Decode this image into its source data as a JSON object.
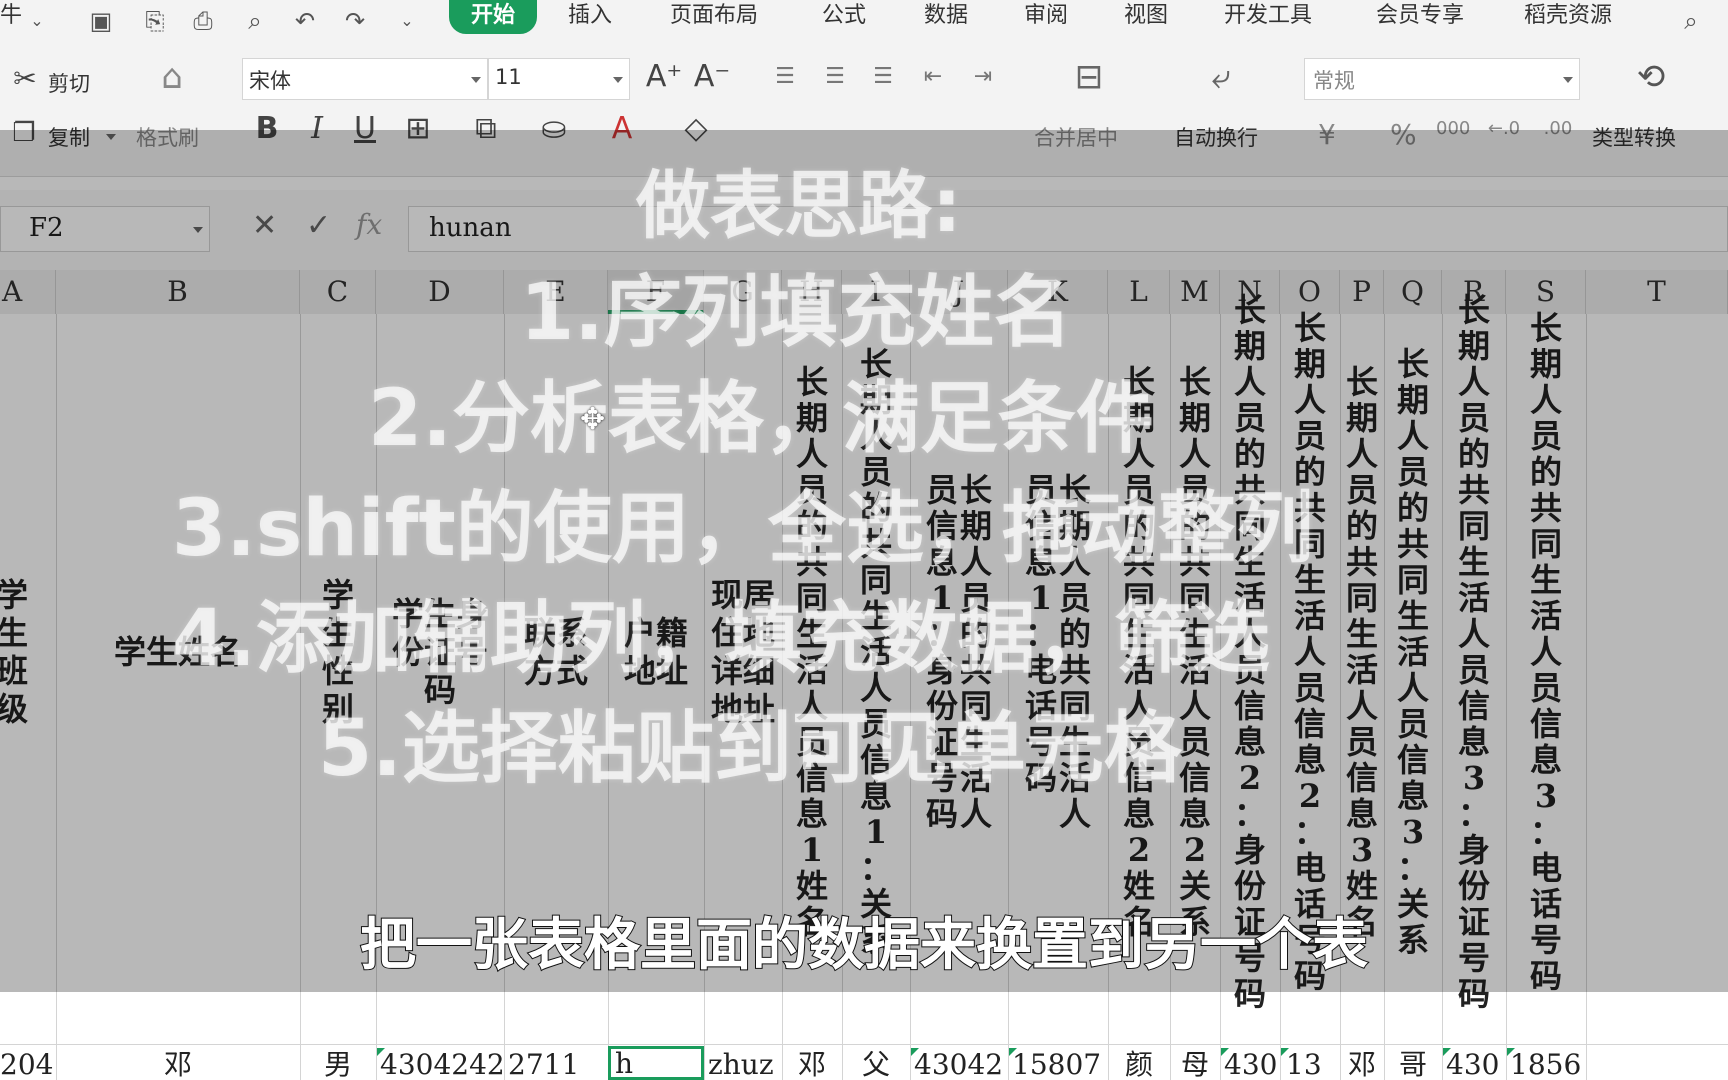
{
  "menubar": {
    "quick_icons": [
      "save-icon",
      "export-icon",
      "print-icon",
      "print-preview-icon",
      "undo-icon",
      "redo-icon",
      "more-icon"
    ],
    "tabs": [
      "开始",
      "插入",
      "页面布局",
      "公式",
      "数据",
      "审阅",
      "视图",
      "开发工具",
      "会员专享",
      "稻壳资源"
    ],
    "active_tab": "开始",
    "left_fragment": "牛"
  },
  "ribbon": {
    "cut": "剪切",
    "copy": "复制",
    "format_painter": "格式刷",
    "font_name": "宋体",
    "font_size": "11",
    "merge_center": "合并居中",
    "wrap_text": "自动换行",
    "number_format": "常规",
    "type_convert": "类型转换",
    "currency": "¥",
    "percent": "%",
    "thousands": "000"
  },
  "formula_bar": {
    "cell_ref": "F2",
    "value": "hunan",
    "fx": "fx"
  },
  "columns": [
    "A",
    "B",
    "C",
    "D",
    "E",
    "F",
    "G",
    "H",
    "I",
    "J",
    "K",
    "L",
    "M",
    "N",
    "O",
    "P",
    "Q",
    "R",
    "S",
    "T"
  ],
  "selected_column": "F",
  "header_row": {
    "A": "学生班级",
    "B": "学生姓名",
    "C": "学生性别",
    "D": "学生身份证号码",
    "E": "联系方式",
    "F": "户籍地址",
    "G": "现居住地详细地址",
    "H": "长期人员的共同生活人员信息1姓名",
    "I": "长期人员的共同生活人员信息1：关系",
    "J": "长期人员的共同生活人员信息1：身份证号码",
    "K": "长期人员的共同生活人员信息1：电话号码",
    "L": "长期人员的共同生活人员信息2姓名",
    "M": "长期人员的共同生活人员信息2关系",
    "N": "长期人员的共同生活人员信息2：身份证号码",
    "O": "长期人员的共同生活人员信息2：电话号码",
    "P": "长期人员的共同生活人员信息3姓名",
    "Q": "长期人员的共同生活人员信息3：关系",
    "R": "长期人员的共同生活人员信息3：身份证号码",
    "S": "长期人员的共同生活人员信息3：电话号码"
  },
  "data_row": {
    "A": "204",
    "B": "邓",
    "C": "男",
    "D": "4304242",
    "E": "2711",
    "F": "h",
    "G": "zhuz",
    "H": "邓",
    "I": "父",
    "J": "43042",
    "K": "15807",
    "L": "颜",
    "M": "母",
    "N": "430",
    "O": "13",
    "P": "邓",
    "Q": "哥",
    "R": "430",
    "S": "1856"
  },
  "overlay": {
    "title": "做表思路:",
    "steps": [
      "1.序列填充姓名",
      "2.分析表格，满足条件",
      "3.shift的使用，全选，拖动整列",
      "4.添加辅助列，填充数据，筛选",
      "5.选择粘贴到可见单元格"
    ],
    "subtitle": "把一张表格里面的数据来换置到另一个表"
  }
}
